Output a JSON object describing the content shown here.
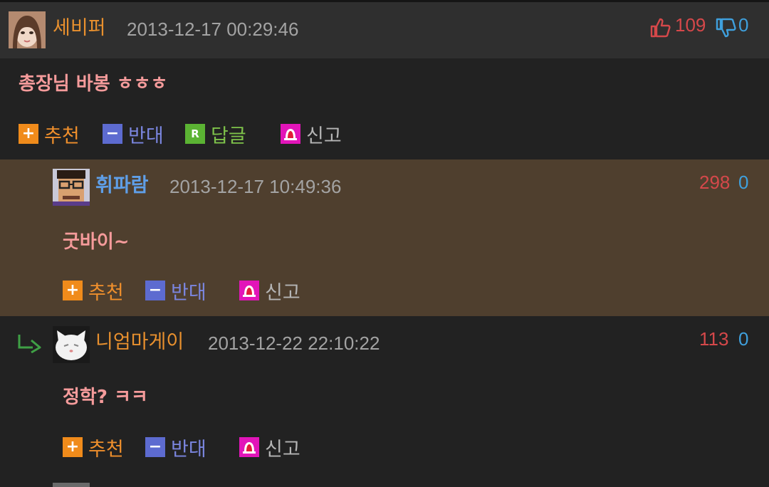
{
  "comments": [
    {
      "nickname": "세비퍼",
      "date": "2013-12-17 00:29:46",
      "likes": "109",
      "dislikes": "0",
      "text": "총장님 바봉 ㅎㅎㅎ",
      "actions": {
        "recommend": "추천",
        "oppose": "반대",
        "reply": "답글",
        "report": "신고"
      },
      "nick_color": "#e8902e"
    },
    {
      "nickname": "휘파람",
      "date": "2013-12-17 10:49:36",
      "likes": "298",
      "dislikes": "0",
      "text": "굿바이~",
      "actions": {
        "recommend": "추천",
        "oppose": "반대",
        "report": "신고"
      },
      "nick_color": "#5f9fe8"
    },
    {
      "nickname": "니엄마게이",
      "date": "2013-12-22 22:10:22",
      "likes": "113",
      "dislikes": "0",
      "text": "정학? ㅋㅋ",
      "actions": {
        "recommend": "추천",
        "oppose": "반대",
        "report": "신고"
      },
      "nick_color": "#e8902e"
    }
  ],
  "icons": {
    "plus": "+",
    "minus": "−",
    "reply": "R"
  },
  "colors": {
    "like": "#d5484a",
    "dislike": "#3fa0dd",
    "highlight_bg": "#4f3f2e"
  }
}
